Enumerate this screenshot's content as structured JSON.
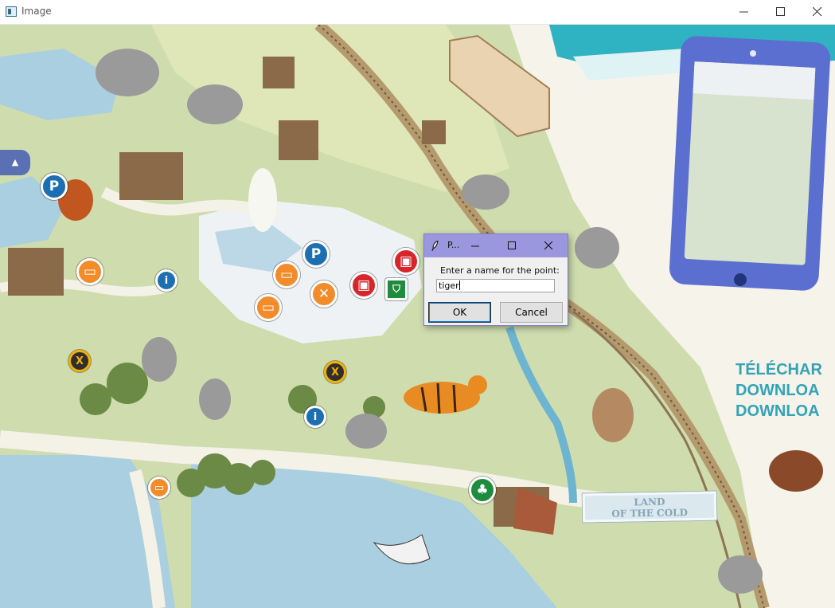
{
  "window": {
    "title": "Image",
    "controls": {
      "minimize": "minimize",
      "maximize": "maximize",
      "close": "close"
    }
  },
  "map": {
    "sign_text": "LAND\nOF THE COLD",
    "promo_lines": [
      "TÉLÉCHAR",
      "DOWNLOA",
      "DOWNLOA"
    ],
    "pins": {
      "parking": "P",
      "exit": "X"
    }
  },
  "dialog": {
    "title": "P...",
    "prompt": "Enter a name for the point:",
    "input_value": "tiger",
    "ok_label": "OK",
    "cancel_label": "Cancel"
  },
  "colors": {
    "dialog_titlebar": "#9a97de",
    "dialog_border": "#7e7ecb",
    "map_green": "#cfdcae",
    "water": "#a9cfe0",
    "path": "#f4f1e6",
    "phone": "#5b6fd0"
  }
}
